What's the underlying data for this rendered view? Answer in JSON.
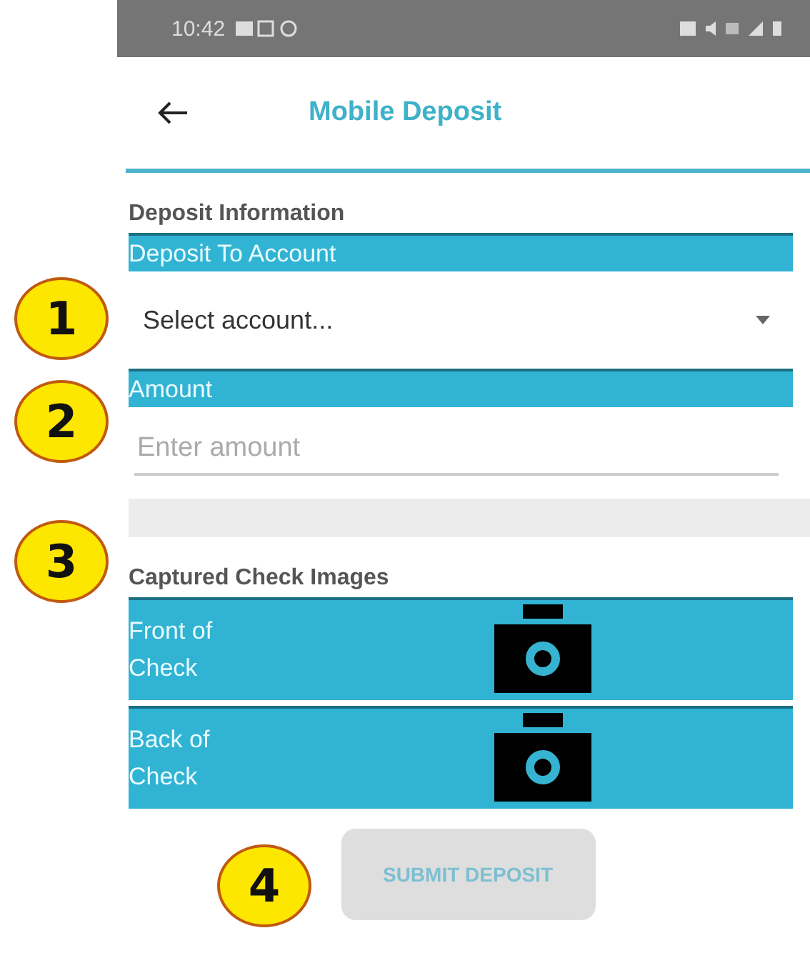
{
  "status_bar": {
    "time": "10:42"
  },
  "header": {
    "title": "Mobile Deposit"
  },
  "section_title": "Deposit Information",
  "fields": [
    {
      "kind": "select",
      "label": "Deposit To Account",
      "value": "Select account..."
    },
    {
      "kind": "input",
      "label": "Amount",
      "placeholder": "Enter amount"
    }
  ],
  "images_title": "Captured Check Images",
  "captures": [
    {
      "label": "Front of Check"
    },
    {
      "label": "Back of Check"
    }
  ],
  "submit": {
    "label": "SUBMIT DEPOSIT",
    "disabled": true
  },
  "callouts": [
    "1",
    "2",
    "3",
    "4"
  ]
}
